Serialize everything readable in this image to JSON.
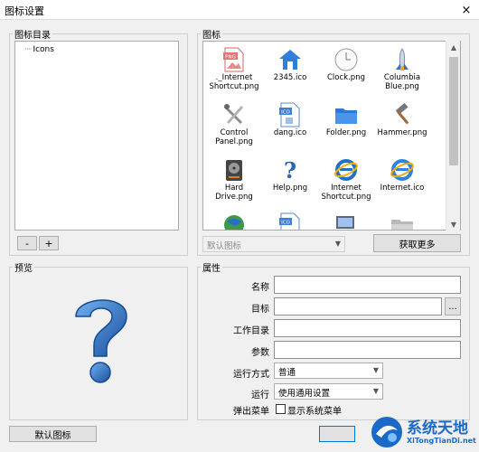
{
  "window": {
    "title": "图标设置",
    "close_glyph": "×"
  },
  "tree_panel": {
    "label": "图标目录",
    "items": [
      {
        "label": "Icons"
      }
    ],
    "remove_label": "-",
    "add_label": "+"
  },
  "icons_panel": {
    "label": "图标",
    "icons": [
      {
        "name": "._Internet\nShortcut.png",
        "icon": "png-file-icon"
      },
      {
        "name": "2345.ico",
        "icon": "house-icon"
      },
      {
        "name": "Clock.png",
        "icon": "clock-icon"
      },
      {
        "name": "Columbia\nBlue.png",
        "icon": "rocket-icon"
      },
      {
        "name": "Control\nPanel.png",
        "icon": "tools-icon"
      },
      {
        "name": "dang.ico",
        "icon": "ico-file-icon"
      },
      {
        "name": "Folder.png",
        "icon": "folder-icon"
      },
      {
        "name": "Hammer.png",
        "icon": "hammer-icon"
      },
      {
        "name": "Hard\nDrive.png",
        "icon": "hard-drive-icon"
      },
      {
        "name": "Help.png",
        "icon": "help-icon"
      },
      {
        "name": "Internet\nShortcut.png",
        "icon": "ie-icon"
      },
      {
        "name": "Internet.ico",
        "icon": "ie-icon"
      }
    ],
    "default_combo": "默认图标",
    "fetch_more": "获取更多"
  },
  "preview_panel": {
    "label": "预览",
    "icon": "question-mark-icon"
  },
  "props_panel": {
    "label": "属性",
    "name_label": "名称",
    "target_label": "目标",
    "browse_label": "...",
    "workdir_label": "工作目录",
    "params_label": "参数",
    "runmode_label": "运行方式",
    "runmode_value": "普通",
    "run_label": "运行",
    "run_value": "使用通用设置",
    "popup_label": "弹出菜单",
    "show_sysmenu_label": "显示系统菜单"
  },
  "footer": {
    "default_icon_button": "默认图标"
  },
  "watermark": {
    "text": "系统天地",
    "url_text": "XiTongTianDi.net"
  },
  "colors": {
    "accent": "#1b6ac9",
    "window_bg": "#f0f0f0"
  }
}
